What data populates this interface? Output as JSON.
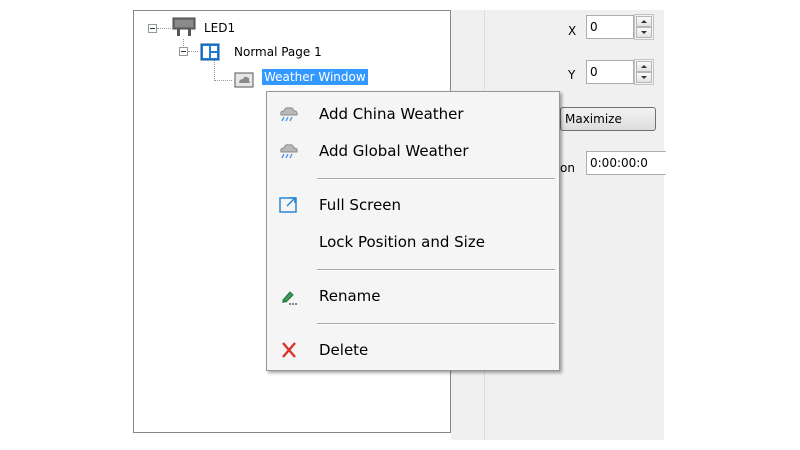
{
  "tree": {
    "nodes": [
      {
        "label": "LED1",
        "icon": "led-screen-icon"
      },
      {
        "label": "Normal Page 1",
        "icon": "page-layout-icon"
      },
      {
        "label": "Weather Window",
        "icon": "weather-cloud-icon",
        "selected": true
      }
    ]
  },
  "properties": {
    "x_label": "X",
    "x_value": "0",
    "y_label": "Y",
    "y_value": "0",
    "maximize_label": "Maximize",
    "duration_label_partial": "on",
    "duration_value": "0:00:00:0"
  },
  "context_menu": {
    "items": [
      {
        "label": "Add China Weather",
        "icon": "weather-rain-icon"
      },
      {
        "label": "Add Global Weather",
        "icon": "weather-rain-icon"
      },
      {
        "label": "Full Screen",
        "icon": "fullscreen-icon"
      },
      {
        "label": "Lock Position and Size",
        "icon": ""
      },
      {
        "label": "Rename",
        "icon": "rename-pen-icon"
      },
      {
        "label": "Delete",
        "icon": "delete-x-icon"
      }
    ]
  },
  "colors": {
    "selection": "#3399ff",
    "delete_red": "#d8352a",
    "panel_bg": "#f0f0f0"
  }
}
